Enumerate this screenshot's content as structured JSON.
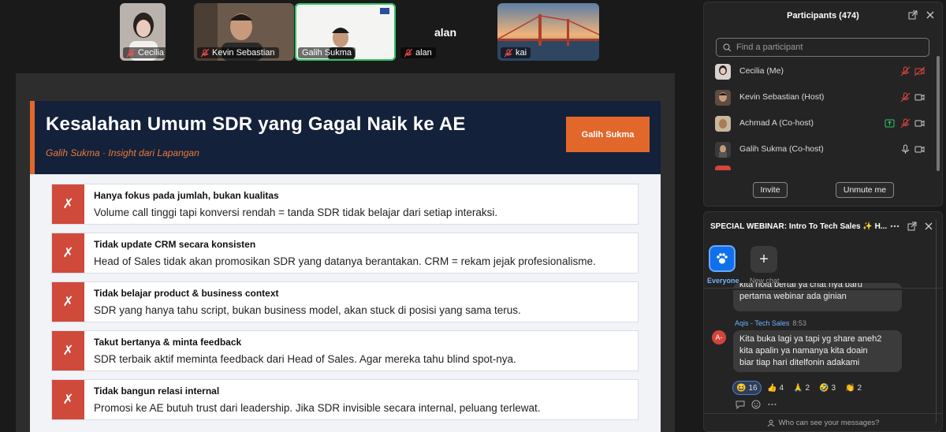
{
  "video_tiles": [
    {
      "name": "Cecilia"
    },
    {
      "name": "Kevin Sebastian"
    },
    {
      "name": "Galih Sukma"
    },
    {
      "name": "alan",
      "label": "alan"
    },
    {
      "name": "kai"
    }
  ],
  "slide": {
    "title": "Kesalahan Umum SDR yang Gagal Naik ke AE",
    "subtitle": "Galih Sukma · Insight dari Lapangan",
    "badge": "Galih Sukma",
    "mark": "✗",
    "items": [
      {
        "title": "Hanya fokus pada jumlah, bukan kualitas",
        "desc": "Volume call tinggi tapi konversi rendah = tanda SDR tidak belajar dari setiap interaksi."
      },
      {
        "title": "Tidak update CRM secara konsisten",
        "desc": "Head of Sales tidak akan promosikan SDR yang datanya berantakan. CRM = rekam jejak profesionalisme."
      },
      {
        "title": "Tidak belajar product & business context",
        "desc": "SDR yang hanya tahu script, bukan business model, akan stuck di posisi yang sama terus."
      },
      {
        "title": "Takut bertanya & minta feedback",
        "desc": "SDR terbaik aktif meminta feedback dari Head of Sales. Agar mereka tahu blind spot-nya."
      },
      {
        "title": "Tidak bangun relasi internal",
        "desc": "Promosi ke AE butuh trust dari leadership. Jika SDR invisible secara internal, peluang terlewat."
      }
    ]
  },
  "participants": {
    "title": "Participants (474)",
    "search_placeholder": "Find a participant",
    "list": [
      {
        "name": "Cecilia (Me)"
      },
      {
        "name": "Kevin Sebastian (Host)"
      },
      {
        "name": "Achmad A (Co-host)"
      },
      {
        "name": "Galih Sukma (Co-host)"
      }
    ],
    "invite_label": "Invite",
    "unmute_label": "Unmute me"
  },
  "chat": {
    "title": "SPECIAL WEBINAR: Intro To Tech Sales ✨ H...",
    "tab_everyone": "Everyone",
    "tab_new": "New chat",
    "prev_message": [
      "kita hola bertai ya chat nya baru",
      "pertama webinar ada ginian"
    ],
    "sender": "Aqis - Tech Sales",
    "time": "8:53",
    "sender_initial": "A-",
    "message": [
      "Kita buka lagi ya tapi yg share aneh2",
      "kita apalin ya namanya kita doain",
      "biar tiap hari ditelfonin adakami"
    ],
    "reactions": [
      {
        "emoji": "😆",
        "count": "16"
      },
      {
        "emoji": "👍",
        "count": "4"
      },
      {
        "emoji": "🙏",
        "count": "2"
      },
      {
        "emoji": "🤣",
        "count": "3"
      },
      {
        "emoji": "👏",
        "count": "2"
      }
    ],
    "footer": "Who can see your messages?"
  },
  "colors": {
    "accent": "#e2672b",
    "navy": "#14213a",
    "zoom_blue": "#0e71eb",
    "mark_red": "#d04a3c"
  }
}
